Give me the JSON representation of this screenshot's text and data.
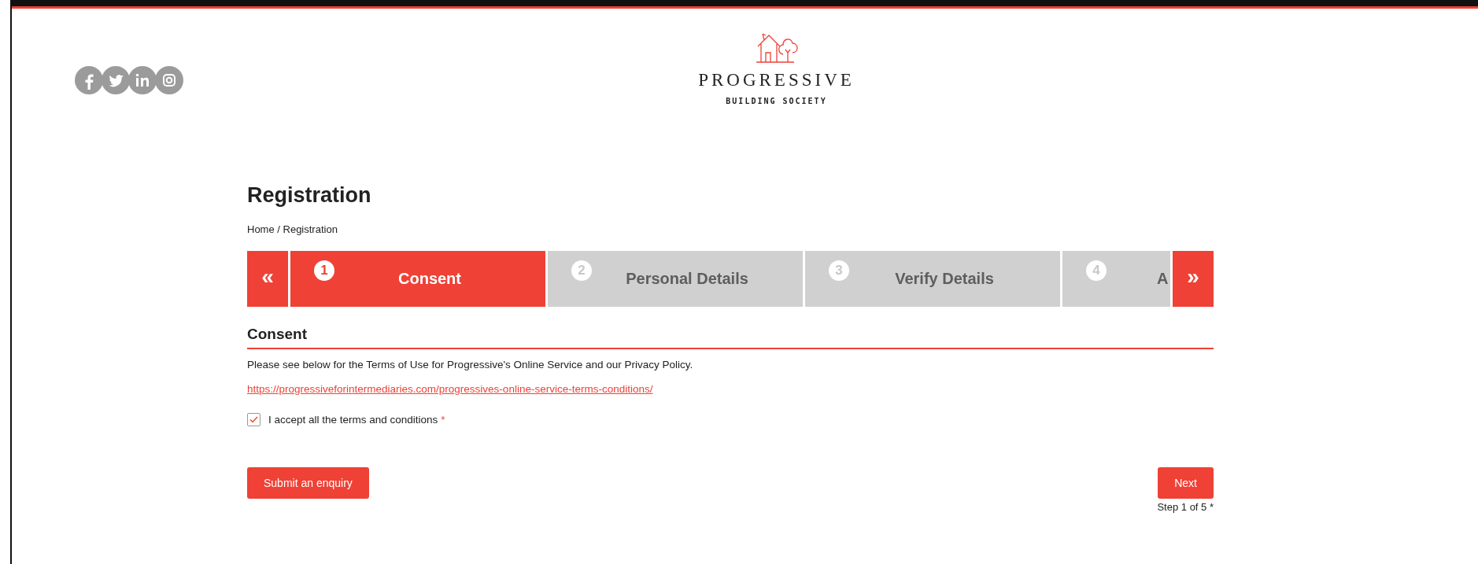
{
  "header": {
    "social": [
      {
        "kind": "facebook"
      },
      {
        "kind": "twitter"
      },
      {
        "kind": "linkedin"
      },
      {
        "kind": "instagram"
      }
    ],
    "logo": {
      "name": "PROGRESSIVE",
      "tagline": "BUILDING SOCIETY"
    }
  },
  "page": {
    "title": "Registration",
    "breadcrumb": "Home / Registration"
  },
  "stepper": {
    "prev": "«",
    "next": "»",
    "steps": [
      {
        "number": "1",
        "label": "Consent",
        "selected": true
      },
      {
        "number": "2",
        "label": "Personal Details",
        "selected": false
      },
      {
        "number": "3",
        "label": "Verify Details",
        "selected": false
      },
      {
        "number": "4",
        "label": "A",
        "selected": false
      }
    ]
  },
  "section": {
    "title": "Consent",
    "text": "Please see below for the Terms of Use for Progressive's Online Service and our Privacy Policy.",
    "link": "https://progressiveforintermediaries.com/progressives-online-service-terms-conditions/",
    "consent": {
      "label": "I accept all the terms and conditions",
      "required": "*",
      "checked": true
    }
  },
  "actions": {
    "enquiry": "Submit an enquiry",
    "next": "Next",
    "step_note": "Step 1 of 5 *"
  }
}
